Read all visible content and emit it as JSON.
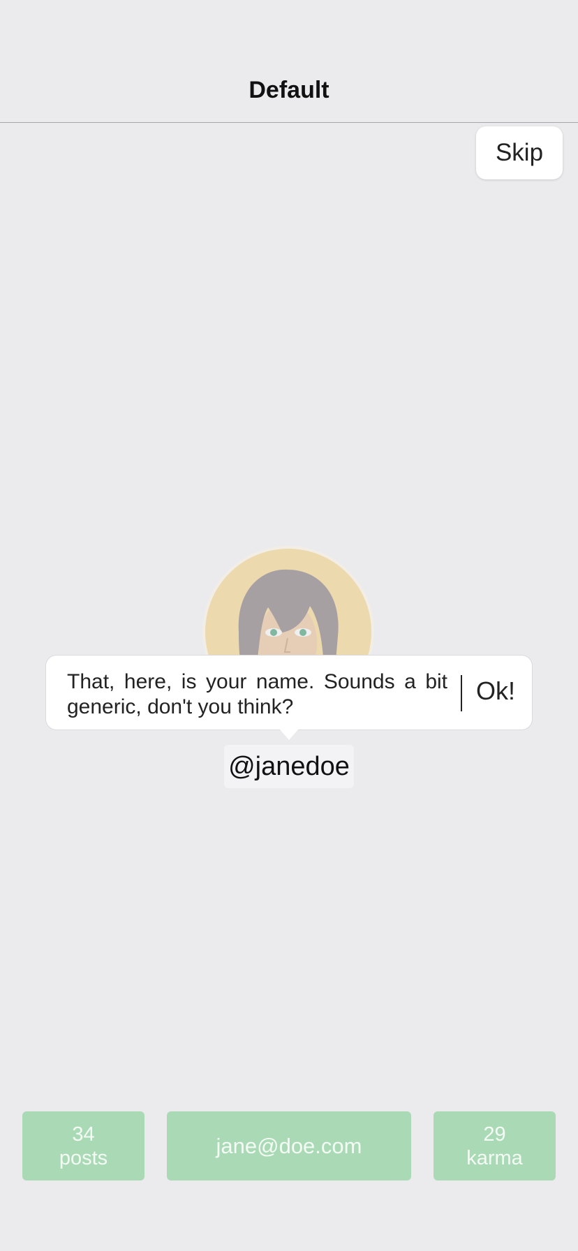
{
  "navbar": {
    "title": "Default"
  },
  "skip_button": {
    "label": "Skip"
  },
  "profile": {
    "username": "@janedoe",
    "avatar_colors": {
      "background": "#ECD9AE",
      "hair": "#A6A0A2",
      "eyes": "#7FB7A0"
    }
  },
  "tooltip": {
    "message": "That, here, is your name. Sounds a bit generic, don't you think?",
    "ok_label": "Ok!"
  },
  "stats": {
    "posts": {
      "value": "34",
      "label": "posts"
    },
    "email": {
      "value": "jane@doe.com"
    },
    "karma": {
      "value": "29",
      "label": "karma"
    }
  },
  "colors": {
    "background": "#EBEBEE",
    "stat_fill": "#A9DAB5",
    "stat_text": "#F4FBF5"
  }
}
